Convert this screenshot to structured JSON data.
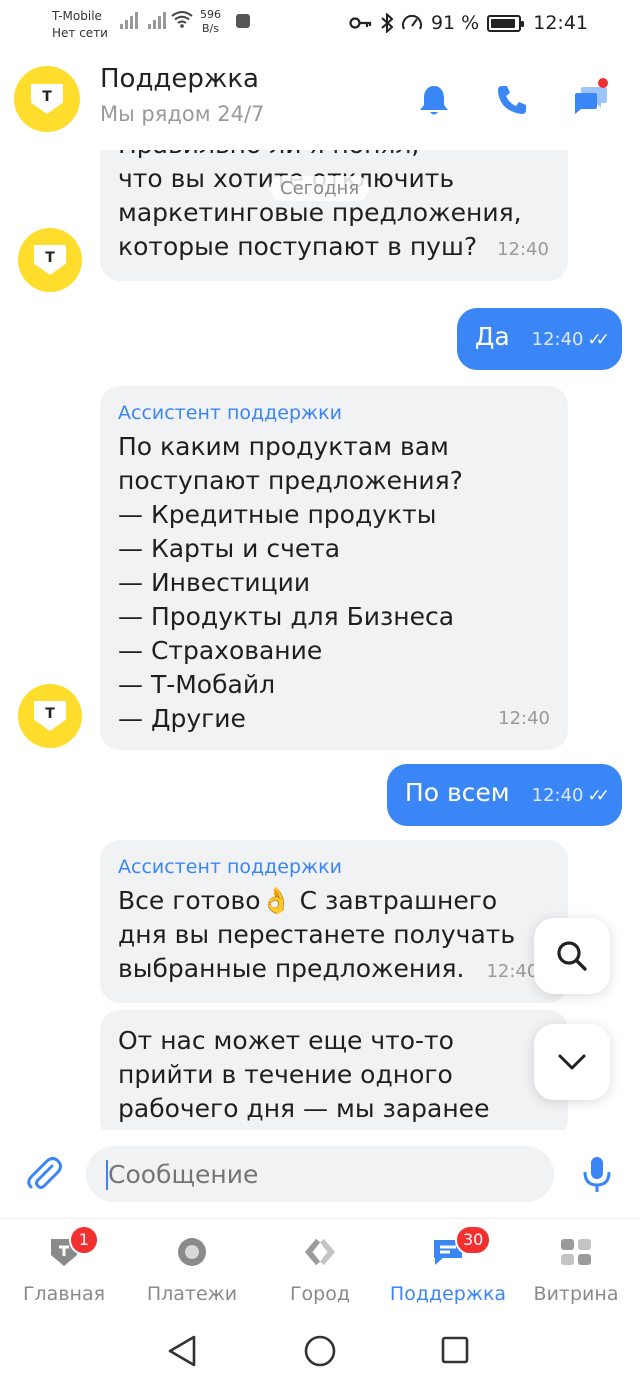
{
  "status_bar": {
    "carrier_line1": "T-Mobile",
    "carrier_line2": "Нет сети",
    "speed_value": "596",
    "speed_unit": "B/s",
    "battery": "91 %",
    "battery_level": 0.91,
    "time": "12:41"
  },
  "header": {
    "logo_letter": "Т",
    "title": "Поддержка",
    "subtitle": "Мы рядом 24/7"
  },
  "chat": {
    "date_separator": "Сегодня",
    "messages": [
      {
        "direction": "in",
        "sender": "",
        "lines": [
          "Правильно ли я понял,",
          "что вы хотите отключить",
          "маркетинговые предложения,",
          "которые поступают в пуш?"
        ],
        "time": "12:40"
      },
      {
        "direction": "out",
        "text": "Да",
        "time": "12:40"
      },
      {
        "direction": "in",
        "sender": "Ассистент поддержки",
        "lines": [
          "По каким продуктам вам",
          "поступают предложения?",
          "— Кредитные продукты",
          "— Карты и счета",
          "— Инвестиции",
          "— Продукты для Бизнеса",
          "— Страхование",
          "— Т-Мобайл",
          "— Другие"
        ],
        "time": "12:40"
      },
      {
        "direction": "out",
        "text": "По всем",
        "time": "12:40"
      },
      {
        "direction": "in",
        "sender": "Ассистент поддержки",
        "lines": [
          "Все готово👌 С завтрашнего",
          "дня вы перестанете получать",
          "выбранные предложения."
        ],
        "time": "12:40"
      },
      {
        "direction": "in",
        "sender": "",
        "lines": [
          "От нас может еще что-то",
          "прийти в течение одного",
          "рабочего дня — мы заранее"
        ],
        "time": ""
      }
    ]
  },
  "input": {
    "placeholder": "Сообщение"
  },
  "bottom_nav": {
    "items": [
      {
        "label": "Главная",
        "badge": "1"
      },
      {
        "label": "Платежи",
        "badge": ""
      },
      {
        "label": "Город",
        "badge": ""
      },
      {
        "label": "Поддержка",
        "badge": "30",
        "active": true
      },
      {
        "label": "Витрина",
        "badge": ""
      }
    ]
  },
  "colors": {
    "accent": "#3b86f6",
    "brand_yellow": "#ffdd2d",
    "bubble_in": "#f1f2f4",
    "badge_red": "#f23030"
  }
}
